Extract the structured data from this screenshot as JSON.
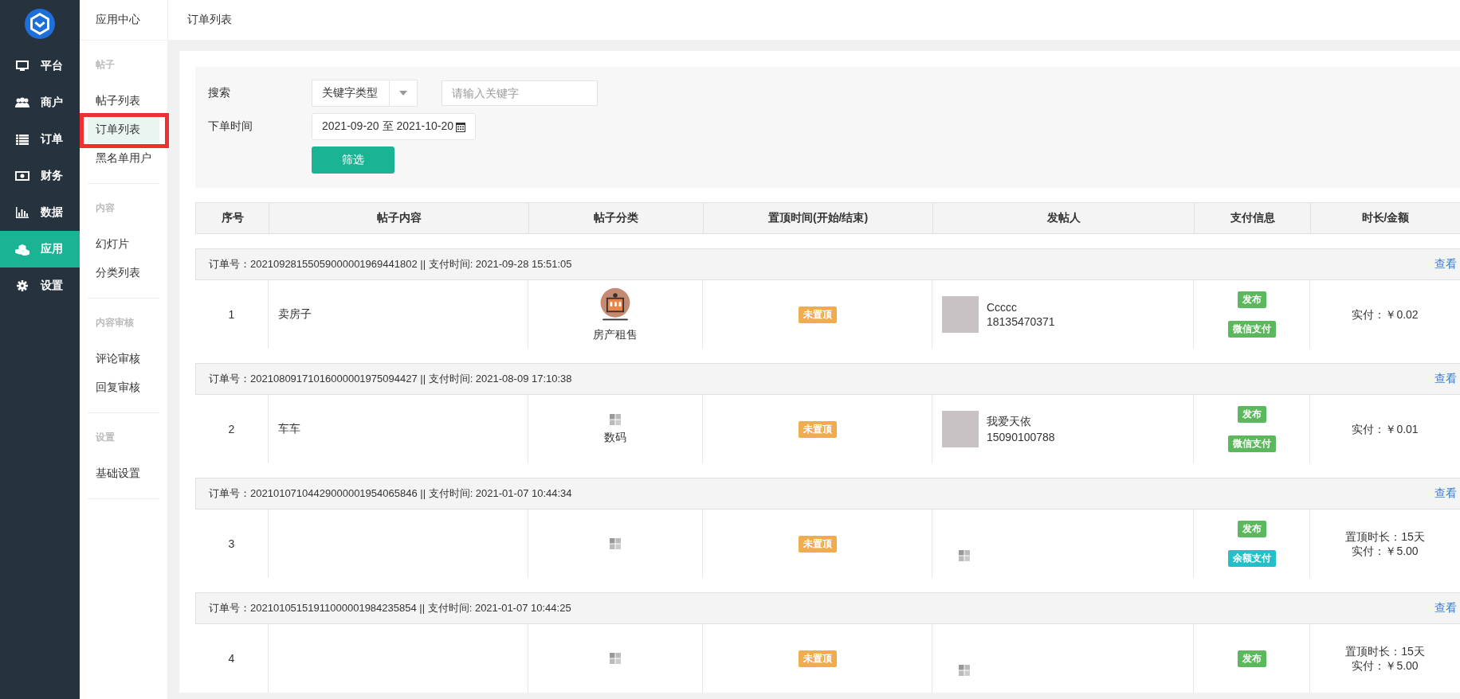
{
  "main_nav": [
    {
      "label": "平台",
      "kind": "monitor",
      "selected": false
    },
    {
      "label": "商户",
      "kind": "users",
      "selected": false
    },
    {
      "label": "订单",
      "kind": "list",
      "selected": false
    },
    {
      "label": "财务",
      "kind": "money",
      "selected": false
    },
    {
      "label": "数据",
      "kind": "chart",
      "selected": false
    },
    {
      "label": "应用",
      "kind": "cubes",
      "selected": true
    },
    {
      "label": "设置",
      "kind": "gear",
      "selected": false
    }
  ],
  "sub_nav": {
    "title": "应用中心",
    "groups": [
      {
        "heading": "帖子",
        "items": [
          {
            "label": "帖子列表",
            "selected": false,
            "highlighted": false
          },
          {
            "label": "订单列表",
            "selected": true,
            "highlighted": true
          },
          {
            "label": "黑名单用户",
            "selected": false,
            "highlighted": false
          }
        ]
      },
      {
        "heading": "内容",
        "items": [
          {
            "label": "幻灯片",
            "selected": false,
            "highlighted": false
          },
          {
            "label": "分类列表",
            "selected": false,
            "highlighted": false
          }
        ]
      },
      {
        "heading": "内容审核",
        "items": [
          {
            "label": "评论审核",
            "selected": false,
            "highlighted": false
          },
          {
            "label": "回复审核",
            "selected": false,
            "highlighted": false
          }
        ]
      },
      {
        "heading": "设置",
        "items": [
          {
            "label": "基础设置",
            "selected": false,
            "highlighted": false
          }
        ]
      }
    ]
  },
  "breadcrumb": "订单列表",
  "filter": {
    "search_label": "搜索",
    "keyword_type": "关键字类型",
    "keyword_placeholder": "请输入关键字",
    "date_label": "下单时间",
    "date_range": "2021-09-20 至 2021-10-20",
    "submit": "筛选"
  },
  "table": {
    "columns": [
      "序号",
      "帖子内容",
      "帖子分类",
      "置顶时间(开始/结束)",
      "发帖人",
      "支付信息",
      "时长/金额"
    ],
    "orders": [
      {
        "order_line": "订单号：20210928155059000001969441802 || 支付时间: 2021-09-28 15:51:05",
        "action": "查看",
        "index": "1",
        "content": "卖房子",
        "category": {
          "kind": "illustration",
          "label": "房产租售"
        },
        "pin_status": {
          "text": "未置顶",
          "color": "#f0ad4e"
        },
        "poster": {
          "kind": "photo",
          "name": "Ccccc",
          "phone": "18135470371"
        },
        "payment_tags": [
          {
            "text": "发布",
            "color": "#5cb85c"
          },
          {
            "text": "微信支付",
            "color": "#5cb85c"
          }
        ],
        "amount_lines": [
          "实付：￥0.02"
        ]
      },
      {
        "order_line": "订单号：20210809171016000001975094427 || 支付时间: 2021-08-09 17:10:38",
        "action": "查看",
        "index": "2",
        "content": "车车",
        "category": {
          "kind": "broken",
          "label": "数码"
        },
        "pin_status": {
          "text": "未置顶",
          "color": "#f0ad4e"
        },
        "poster": {
          "kind": "photo",
          "name": "我爱天依",
          "phone": "15090100788"
        },
        "payment_tags": [
          {
            "text": "发布",
            "color": "#5cb85c"
          },
          {
            "text": "微信支付",
            "color": "#5cb85c"
          }
        ],
        "amount_lines": [
          "实付：￥0.01"
        ]
      },
      {
        "order_line": "订单号：20210107104429000001954065846 || 支付时间: 2021-01-07 10:44:34",
        "action": "查看",
        "index": "3",
        "category": {
          "kind": "broken"
        },
        "pin_status": {
          "text": "未置顶",
          "color": "#f0ad4e"
        },
        "poster": {
          "kind": "broken"
        },
        "payment_tags": [
          {
            "text": "发布",
            "color": "#5cb85c"
          },
          {
            "text": "余额支付",
            "color": "#23c0c9"
          }
        ],
        "amount_lines": [
          "置顶时长：15天",
          "实付：￥5.00"
        ]
      },
      {
        "order_line": "订单号：20210105151911000001984235854 || 支付时间: 2021-01-07 10:44:25",
        "action": "查看",
        "index": "4",
        "category": {
          "kind": "broken"
        },
        "pin_status": {
          "text": "未置顶",
          "color": "#f0ad4e"
        },
        "poster": {
          "kind": "broken"
        },
        "payment_tags": [
          {
            "text": "发布",
            "color": "#5cb85c"
          }
        ],
        "amount_lines": [
          "置顶时长：15天",
          "实付：￥5.00"
        ]
      }
    ]
  }
}
